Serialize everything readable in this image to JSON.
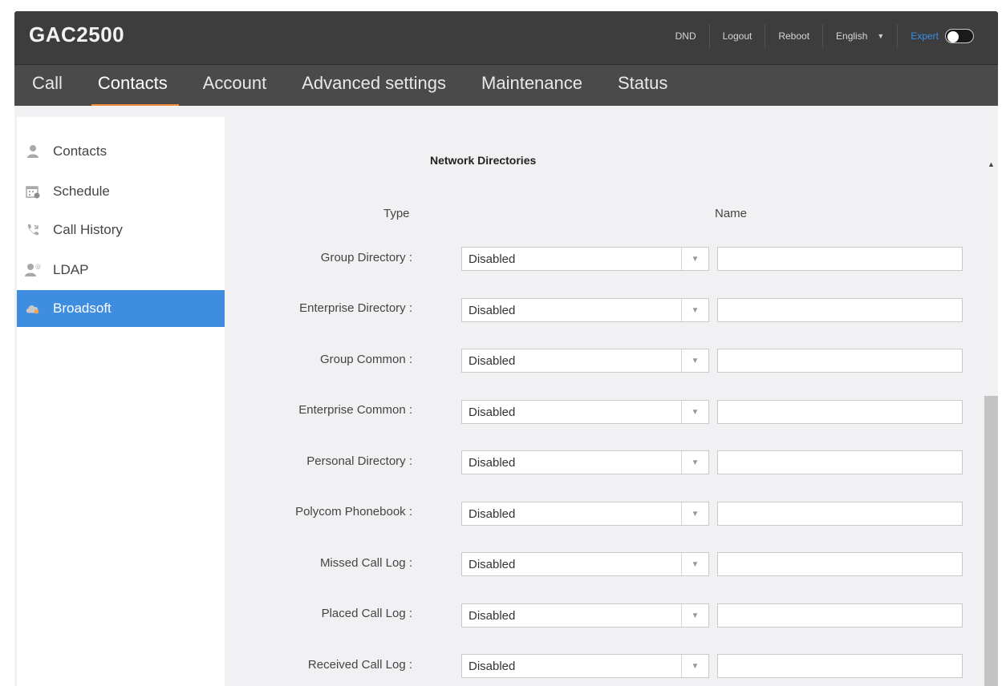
{
  "app": {
    "title": "GAC2500"
  },
  "top_actions": {
    "dnd": "DND",
    "logout": "Logout",
    "reboot": "Reboot",
    "language": "English",
    "expert": "Expert",
    "expert_enabled": false
  },
  "nav": {
    "tabs": [
      {
        "label": "Call",
        "active": false
      },
      {
        "label": "Contacts",
        "active": true
      },
      {
        "label": "Account",
        "active": false
      },
      {
        "label": "Advanced settings",
        "active": false
      },
      {
        "label": "Maintenance",
        "active": false
      },
      {
        "label": "Status",
        "active": false
      }
    ],
    "active_color": "#f28b3a"
  },
  "sidebar": {
    "items": [
      {
        "label": "Contacts",
        "icon": "person-icon",
        "active": false
      },
      {
        "label": "Schedule",
        "icon": "calendar-icon",
        "active": false
      },
      {
        "label": "Call History",
        "icon": "call-history-icon",
        "active": false
      },
      {
        "label": "LDAP",
        "icon": "ldap-icon",
        "active": false
      },
      {
        "label": "Broadsoft",
        "icon": "cloud-icon",
        "active": true
      }
    ],
    "active_color": "#3f8de0"
  },
  "main": {
    "section_title": "Network Directories",
    "col_type": "Type",
    "col_name": "Name",
    "rows": [
      {
        "label": "Group Directory :",
        "value": "Disabled",
        "name": ""
      },
      {
        "label": "Enterprise Directory :",
        "value": "Disabled",
        "name": ""
      },
      {
        "label": "Group Common :",
        "value": "Disabled",
        "name": ""
      },
      {
        "label": "Enterprise Common :",
        "value": "Disabled",
        "name": ""
      },
      {
        "label": "Personal Directory :",
        "value": "Disabled",
        "name": ""
      },
      {
        "label": "Polycom Phonebook :",
        "value": "Disabled",
        "name": ""
      },
      {
        "label": "Missed Call Log :",
        "value": "Disabled",
        "name": ""
      },
      {
        "label": "Placed Call Log :",
        "value": "Disabled",
        "name": ""
      },
      {
        "label": "Received Call Log :",
        "value": "Disabled",
        "name": ""
      }
    ]
  }
}
